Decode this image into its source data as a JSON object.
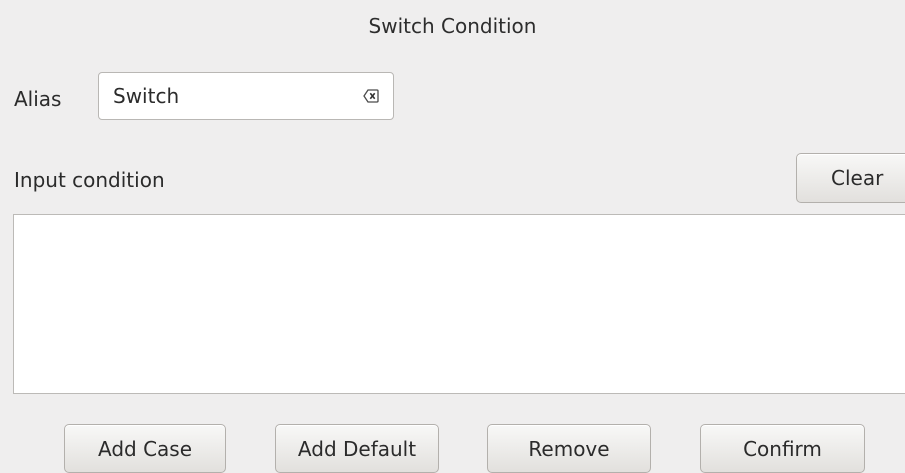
{
  "dialog": {
    "title": "Switch Condition"
  },
  "alias": {
    "label": "Alias",
    "value": "Switch"
  },
  "input_condition": {
    "label": "Input condition",
    "clear_label": "Clear",
    "value": ""
  },
  "actions": {
    "add_case_label": "Add Case",
    "add_default_label": "Add Default",
    "remove_label": "Remove",
    "confirm_label": "Confirm"
  },
  "icons": {
    "alias_clear": "backspace-clear-icon"
  }
}
